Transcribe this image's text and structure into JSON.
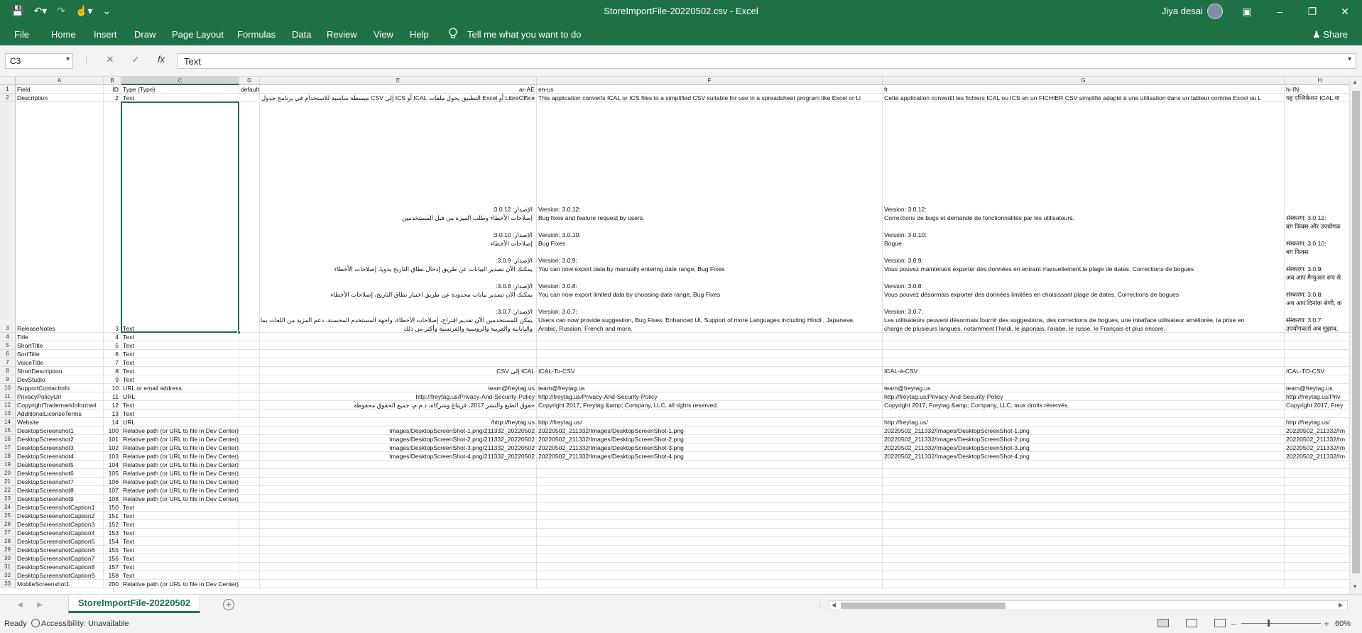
{
  "titlebar": {
    "title": "StoreImportFile-20220502.csv  -  Excel",
    "user": "Jiya desai",
    "min": "–",
    "restore": "❐",
    "close": "✕"
  },
  "ribbon": {
    "tabs": [
      "File",
      "Home",
      "Insert",
      "Draw",
      "Page Layout",
      "Formulas",
      "Data",
      "Review",
      "View",
      "Help"
    ],
    "tell_me": "Tell me what you want to do",
    "share": "Share"
  },
  "formula_bar": {
    "name_box": "C3",
    "content": "Text",
    "fx": "fx"
  },
  "columns": [
    "A",
    "B",
    "C",
    "D",
    "E",
    "F",
    "G",
    "H"
  ],
  "rows": [
    [
      "1",
      "Field",
      "ID",
      "Type (Type)",
      "default",
      "ar-AE",
      "en-us",
      "fr",
      "hi-IN"
    ],
    [
      "2",
      "Description",
      "2",
      "Text",
      "",
      "LibreOffice أو Excel التطبيق يحول ملفات ICAL أو ICS إلى CSV مبسطة مناسبة للاستخدام في برنامج جدول بيانات مثل",
      "This application converts ICAL or ICS files to a simplified CSV suitable for use in a spreadsheet program like Excel or Li",
      "Cette application convertit les fichiers ICAL ou ICS en un FICHIER CSV simplifié adapté à une utilisation dans un tableur comme Excel ou L",
      "यह एप्लिकेशन ICAL या"
    ],
    [
      "3",
      "ReleaseNotes",
      "3",
      "Text",
      "",
      "",
      "",
      "",
      ""
    ],
    [
      "4",
      "Title",
      "4",
      "Text",
      "",
      "",
      "",
      "",
      ""
    ],
    [
      "5",
      "ShortTitle",
      "5",
      "Text",
      "",
      "",
      "",
      "",
      ""
    ],
    [
      "6",
      "SortTitle",
      "6",
      "Text",
      "",
      "",
      "",
      "",
      ""
    ],
    [
      "7",
      "VoiceTitle",
      "7",
      "Text",
      "",
      "",
      "",
      "",
      ""
    ],
    [
      "8",
      "ShortDescription",
      "8",
      "Text",
      "",
      "ICAL إلى CSV",
      "ICAL-To-CSV",
      "ICAL-à-CSV",
      "ICAL-TO-CSV"
    ],
    [
      "9",
      "DevStudio",
      "9",
      "Text",
      "",
      "",
      "",
      "",
      ""
    ],
    [
      "10",
      "SupportContactInfo",
      "10",
      "URL or email address",
      "",
      "team@freytag.us",
      "team@freytag.us",
      "team@freytag.us",
      "team@freytag.us"
    ],
    [
      "11",
      "PrivacyPolicyUrl",
      "11",
      "URL",
      "",
      "http://freytag.us/Privacy-And-Security-Policy",
      "http://freytag.us/Privacy-And-Security-Policy",
      "http://freytag.us/Privacy-And-Security-Policy",
      "http://freytag.us/Priv"
    ],
    [
      "12",
      "CopyrightTrademarkInformati",
      "12",
      "Text",
      "",
      "حقوق الطبع والنشر 2017، فريتاغ وشركاه، ذ م م، جميع الحقوق محفوظة",
      "Copyright 2017, Freytag &amp; Company, LLC, all rights reserved.",
      "Copyright 2017, Freytag &amp; Company, LLC, tous droits réservés.",
      "Copyright 2017, Frey"
    ],
    [
      "13",
      "AdditionalLicenseTerms",
      "13",
      "Text",
      "",
      "",
      "",
      "",
      ""
    ],
    [
      "14",
      "Website",
      "14",
      "URL",
      "",
      "http://freytag.us/",
      "http://freytag.us/",
      "http://freytag.us/",
      "http://freytag.us/"
    ],
    [
      "15",
      "DesktopScreenshot1",
      "100",
      "Relative path (or URL to file in Dev Center)",
      "",
      "20220502_211332/Images/DesktopScreenShot-1.png",
      "20220502_211332/Images/DesktopScreenShot-1.png",
      "20220502_211332/Images/DesktopScreenShot-1.png",
      "20220502_211332/Im"
    ],
    [
      "16",
      "DesktopScreenshot2",
      "101",
      "Relative path (or URL to file in Dev Center)",
      "",
      "20220502_211332/Images/DesktopScreenShot-2.png",
      "20220502_211332/Images/DesktopScreenShot-2.png",
      "20220502_211332/Images/DesktopScreenShot-2.png",
      "20220502_211332/Im"
    ],
    [
      "17",
      "DesktopScreenshot3",
      "102",
      "Relative path (or URL to file in Dev Center)",
      "",
      "20220502_211332/Images/DesktopScreenShot-3.png",
      "20220502_211332/Images/DesktopScreenShot-3.png",
      "20220502_211332/Images/DesktopScreenShot-3.png",
      "20220502_211332/Im"
    ],
    [
      "18",
      "DesktopScreenshot4",
      "103",
      "Relative path (or URL to file in Dev Center)",
      "",
      "20220502_211332/Images/DesktopScreenShot-4.png",
      "20220502_211332/Images/DesktopScreenShot-4.png",
      "20220502_211332/Images/DesktopScreenShot-4.png",
      "20220502_211332/Im"
    ],
    [
      "19",
      "DesktopScreenshot5",
      "104",
      "Relative path (or URL to file in Dev Center)",
      "",
      "",
      "",
      "",
      ""
    ],
    [
      "20",
      "DesktopScreenshot6",
      "105",
      "Relative path (or URL to file in Dev Center)",
      "",
      "",
      "",
      "",
      ""
    ],
    [
      "21",
      "DesktopScreenshot7",
      "106",
      "Relative path (or URL to file in Dev Center)",
      "",
      "",
      "",
      "",
      ""
    ],
    [
      "22",
      "DesktopScreenshot8",
      "107",
      "Relative path (or URL to file in Dev Center)",
      "",
      "",
      "",
      "",
      ""
    ],
    [
      "23",
      "DesktopScreenshot9",
      "108",
      "Relative path (or URL to file in Dev Center)",
      "",
      "",
      "",
      "",
      ""
    ],
    [
      "24",
      "DesktopScreenshotCaption1",
      "150",
      "Text",
      "",
      "",
      "",
      "",
      ""
    ],
    [
      "25",
      "DesktopScreenshotCaption2",
      "151",
      "Text",
      "",
      "",
      "",
      "",
      ""
    ],
    [
      "26",
      "DesktopScreenshotCaption3",
      "152",
      "Text",
      "",
      "",
      "",
      "",
      ""
    ],
    [
      "27",
      "DesktopScreenshotCaption4",
      "153",
      "Text",
      "",
      "",
      "",
      "",
      ""
    ],
    [
      "28",
      "DesktopScreenshotCaption5",
      "154",
      "Text",
      "",
      "",
      "",
      "",
      ""
    ],
    [
      "29",
      "DesktopScreenshotCaption6",
      "155",
      "Text",
      "",
      "",
      "",
      "",
      ""
    ],
    [
      "30",
      "DesktopScreenshotCaption7",
      "156",
      "Text",
      "",
      "",
      "",
      "",
      ""
    ],
    [
      "31",
      "DesktopScreenshotCaption8",
      "157",
      "Text",
      "",
      "",
      "",
      "",
      ""
    ],
    [
      "32",
      "DesktopScreenshotCaption9",
      "158",
      "Text",
      "",
      "",
      "",
      "",
      ""
    ],
    [
      "33",
      "MobileScreenshot1",
      "200",
      "Relative path (or URL to file in Dev Center)",
      "",
      "",
      "",
      "",
      ""
    ]
  ],
  "release_notes": {
    "ar": "الإصدار: 3.0.12:\nإصلاحات الأخطاء وطلب الميزة من قبل المستخدمين\n\nالإصدار: 3.0.10:\nإصلاحات الأخطاء\n\nالإصدار: 3.0.9:\nيمكنك الآن تصدير البيانات عن طريق إدخال نطاق التاريخ يدويا، إصلاحات الأخطاء\n\nالإصدار: 3.0.8:\nيمكنك الآن تصدير بيانات محدودة عن طريق اختيار نطاق التاريخ، إصلاحات الأخطاء\n\nالإصدار: 3.0.7:\nيمكن للمستخدمين الآن تقديم اقتراح، إصلاحات الأخطاء، واجهة المستخدم المحسنة، دعم المزيد من اللغات بما في ذلك الهندية\nواليابانية والعربية والروسية والفرنسية وأكثر من ذلك",
    "en": "Version: 3.0.12:\nBug fixes and feature request by users.\n\nVersion: 3.0.10:\nBug Fixes\n\nVersion: 3.0.9:\nYou can now export data by manually entering date range, Bug Fixes\n\nVersion: 3.0.8:\nYou can now export limited data by choosing date range, Bug Fixes\n\nVersion: 3.0.7:\nUsers can now provide suggestion, Bug Fixes, Enhanced UI, Support of more Languages including Hindi , Japanese,\nArabic, Russian, French and more.",
    "fr": "Version: 3.0.12:\nCorrections de bugs et demande de fonctionnalités par les utilisateurs.\n\nVersion: 3.0.10:\nBogue\n\nVersion: 3.0.9:\nVous pouvez maintenant exporter des données en entrant manuellement la plage de dates, Corrections de bogues\n\nVersion: 3.0.8:\nVous pouvez désormais exporter des données limitées en choisissant plage de dates, Corrections de bogues\n\nVersion: 3.0.7:\nLes utilisateurs peuvent désormais fournir des suggestions, des corrections de bogues, une interface utilisateur améliorée, la prise en\ncharge de plusieurs langues, notamment l'hindi, le japonais, l'arabe, le russe, le Français et plus encore.",
    "hi": "संस्करण: 3.0.12:\nबग फिक्स और उपयोगक\n\nसंस्करण: 3.0.10:\nबग फिक्स\n\nसंस्करण: 3.0.9:\nअब आप मैन्युअल रूप से\n\nसंस्करण: 3.0.8:\nअब आप दिनांक श्रेणी, क\n\nसंस्करण: 3.0.7:\nउपयोगकर्ता अब सुझाव,"
  },
  "sheet_tab": "StoreImportFile-20220502",
  "status": {
    "ready": "Ready",
    "accessibility": "Accessibility: Unavailable",
    "zoom": "60%",
    "minus": "–",
    "plus": "+"
  }
}
